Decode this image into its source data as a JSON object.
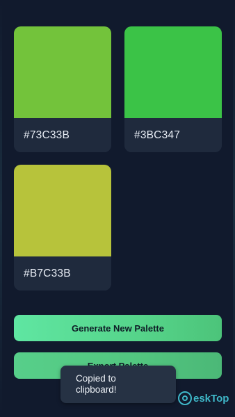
{
  "palette": {
    "swatches": [
      {
        "color": "#73C33B",
        "label": "#73C33B"
      },
      {
        "color": "#3BC347",
        "label": "#3BC347"
      },
      {
        "color": "#B7C33B",
        "label": "#B7C33B"
      }
    ]
  },
  "actions": {
    "generate_label": "Generate New Palette",
    "export_label": "Export Palette"
  },
  "toast": {
    "message": "Copied to clipboard!"
  },
  "watermark": {
    "text": "eskTop"
  },
  "colors": {
    "background": "#111a2d",
    "card": "#1f2a3d",
    "accent_green": "#5fe6a2",
    "watermark": "#3fb8c9"
  }
}
